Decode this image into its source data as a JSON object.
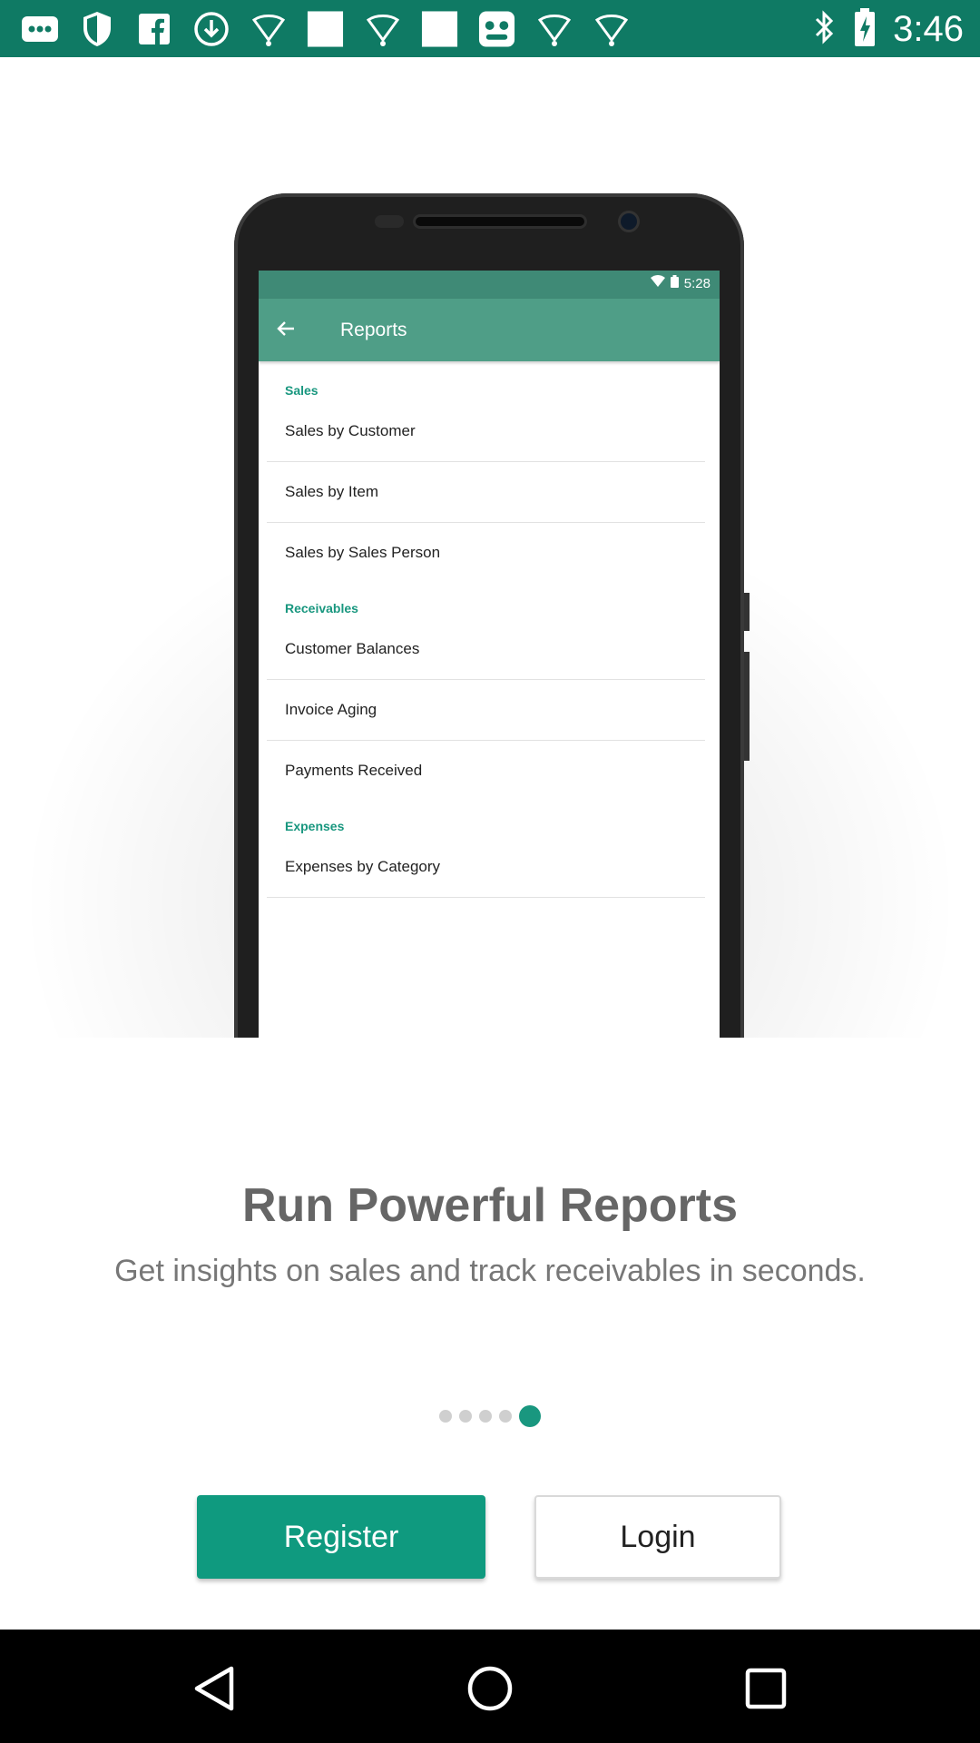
{
  "status_bar": {
    "time": "3:46",
    "icons": [
      "more-icon",
      "shield-icon",
      "facebook-icon",
      "download-icon",
      "lightbulb-icon",
      "blank-icon",
      "lightbulb-icon",
      "blank-icon",
      "game-icon",
      "lightbulb-icon",
      "lightbulb-icon"
    ],
    "right_icons": [
      "bluetooth-icon",
      "battery-icon"
    ]
  },
  "phone_screen": {
    "time": "5:28",
    "title": "Reports",
    "sections": [
      {
        "label": "Sales",
        "items": [
          "Sales by Customer",
          "Sales by Item",
          "Sales by Sales Person"
        ]
      },
      {
        "label": "Receivables",
        "items": [
          "Customer Balances",
          "Invoice Aging",
          "Payments Received"
        ]
      },
      {
        "label": "Expenses",
        "items": [
          "Expenses by Category"
        ]
      }
    ]
  },
  "onboarding": {
    "title": "Run Powerful Reports",
    "subtitle": "Get insights on sales and track receivables in seconds.",
    "page_count": 5,
    "active_page": 5
  },
  "buttons": {
    "register": "Register",
    "login": "Login"
  },
  "colors": {
    "status_bar": "#0f7a64",
    "accent": "#0f9a7f",
    "section_label": "#19977f"
  }
}
